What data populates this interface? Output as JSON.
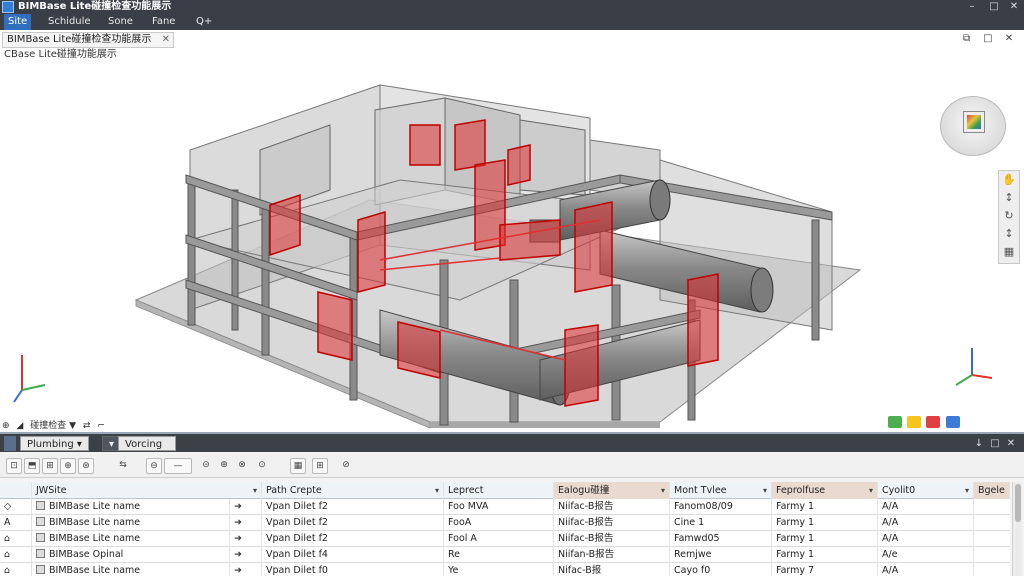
{
  "window": {
    "title": "BIMBase Lite碰撞检查功能展示",
    "controls": {
      "minimize": "–",
      "maximize": "□",
      "close": "✕"
    }
  },
  "menu": {
    "items": [
      {
        "label": "Site",
        "active": true
      },
      {
        "label": "Schidule"
      },
      {
        "label": "Sone"
      },
      {
        "label": "Fane"
      },
      {
        "label": "Q+"
      }
    ]
  },
  "document": {
    "tab_label": "BIMBase Lite碰撞检查功能展示",
    "tab_close": "✕",
    "scene_label": "CBase Lite碰撞功能展示",
    "view_buttons": [
      "⧉",
      "□",
      "✕"
    ]
  },
  "viewport": {
    "accent_clash": "#e03030",
    "status_left": [
      "⊕",
      "◢",
      "碰撞检查 ▼",
      "⇄",
      "⌐"
    ],
    "status_right_colors": [
      "#4caf50",
      "#f5c518",
      "#e04040",
      "#3c7bd6"
    ]
  },
  "nav_tools": {
    "icons": [
      "✋",
      "↕",
      "↻",
      "↕",
      "▦"
    ]
  },
  "panel": {
    "tabs": [
      {
        "label": "Plumbing ▾",
        "dark": false
      },
      {
        "label": "▾",
        "dark": true
      },
      {
        "label": "Vorcing",
        "dark": false
      }
    ],
    "controls": [
      "↓",
      "□",
      "✕"
    ],
    "toolbar_icons": [
      "⊡",
      "⬒",
      "⊞",
      "⊕",
      "⊛",
      "⇆",
      "⊖",
      "—",
      "⊝",
      "⊕",
      "⊗",
      "⊙",
      "▦",
      "⊞",
      "⊘"
    ]
  },
  "table": {
    "columns": [
      {
        "label": "",
        "sort": ""
      },
      {
        "label": "JWSite",
        "sort": "▾"
      },
      {
        "label": "Path Crepte",
        "sort": "▾"
      },
      {
        "label": "Leprect",
        "sort": ""
      },
      {
        "label": "Ealogu碰撞",
        "sort": "▾",
        "hl": true
      },
      {
        "label": "Mont Tvlee",
        "sort": "▾"
      },
      {
        "label": "Feprolfuse",
        "sort": "▾"
      },
      {
        "label": "Cyolit0",
        "sort": "▾"
      },
      {
        "label": "Bgele",
        "sort": "",
        "hl": true
      }
    ],
    "rows": [
      {
        "icon": "◇",
        "site": "BIMBase Lite name",
        "arrow": "➜",
        "path": "Vpan Dilet f2",
        "project": "Foo MVA",
        "ealogu": "Niifac-B报告",
        "mont": "Fanom08/09",
        "feprol": "Farmy 1",
        "cyol": "A/A"
      },
      {
        "icon": "A",
        "site": "BIMBase Lite name",
        "arrow": "➜",
        "path": "Vpan Dilet f2",
        "project": "FooA",
        "ealogu": "Niifac-B报告",
        "mont": "Cine 1",
        "feprol": "Farmy 1",
        "cyol": "A/A"
      },
      {
        "icon": "⌂",
        "site": "BIMBase Lite name",
        "arrow": "➜",
        "path": "Vpan Dilet f2",
        "project": "Fool A",
        "ealogu": "Niifac-B报告",
        "mont": "Famwd05",
        "feprol": "Farmy 1",
        "cyol": "A/A"
      },
      {
        "icon": "⌂",
        "site": "BIMBase Opinal",
        "arrow": "➜",
        "path": "Vpan Dilet f4",
        "project": "Re",
        "ealogu": "Niifan-B报告",
        "mont": "Remjwe",
        "feprol": "Farmy 1",
        "cyol": "A/e"
      },
      {
        "icon": "⌂",
        "site": "BIMBase Lite name",
        "arrow": "➜",
        "path": "Vpan Dilet f0",
        "project": "Ye",
        "ealogu": "Nifac-B报",
        "mont": "Cayo f0",
        "feprol": "Farmy 7",
        "cyol": "A/A"
      }
    ]
  }
}
